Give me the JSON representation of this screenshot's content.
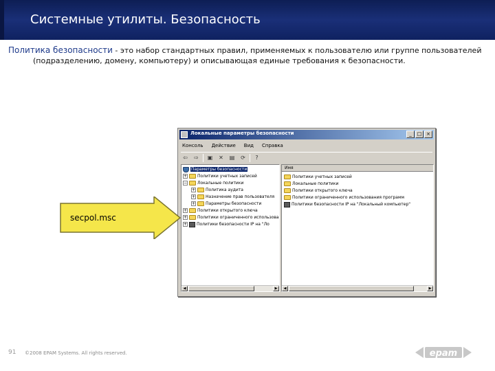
{
  "slide": {
    "title": "Системные утилиты. Безопасность",
    "definition_term": "Политика безопасности",
    "definition_rest": " - это набор стандартных правил, применяемых к пользователю или группе пользователей",
    "definition_line2": "(подразделению, домену, компьютеру) и описывающая единые требования к безопасности.",
    "callout_label": "secpol.msc",
    "page_number": "91",
    "copyright": "©2008 EPAM Systems. All rights reserved.",
    "logo_text": "epam",
    "accent_color": "#1a2f78",
    "arrow_color": "#f5e64a"
  },
  "window": {
    "title": "Локальные параметры безопасности",
    "buttons": {
      "minimize": "_",
      "maximize": "□",
      "close": "×"
    },
    "menu": [
      "Консоль",
      "Действие",
      "Вид",
      "Справка"
    ],
    "toolbar_icons": [
      "back-icon",
      "forward-icon",
      "up-icon",
      "delete-icon",
      "properties-icon",
      "refresh-icon",
      "help-icon"
    ],
    "tree": [
      {
        "label": "Параметры безопасности",
        "selected": true,
        "expander": "−",
        "icon": "shield"
      },
      {
        "label": "Политики учетных записей",
        "expander": "+",
        "icon": "folder"
      },
      {
        "label": "Локальные политики",
        "expander": "−",
        "icon": "folder"
      },
      {
        "label": "Политика аудита",
        "expander": "+",
        "icon": "folder"
      },
      {
        "label": "Назначение прав пользователя",
        "expander": "+",
        "icon": "folder"
      },
      {
        "label": "Параметры безопасности",
        "expander": "+",
        "icon": "folder"
      },
      {
        "label": "Политики открытого ключа",
        "expander": "+",
        "icon": "folder"
      },
      {
        "label": "Политики ограниченного использова",
        "expander": "+",
        "icon": "folder"
      },
      {
        "label": "Политики безопасности IP на \"Ло",
        "expander": "+",
        "icon": "net"
      }
    ],
    "list_header": "Имя",
    "list": [
      {
        "label": "Политики учетных записей",
        "icon": "folder"
      },
      {
        "label": "Локальные политики",
        "icon": "folder"
      },
      {
        "label": "Политики открытого ключа",
        "icon": "folder"
      },
      {
        "label": "Политики ограниченного использования программ",
        "icon": "folder"
      },
      {
        "label": "Политики безопасности IP на \"Локальный компьютер\"",
        "icon": "net"
      }
    ]
  }
}
